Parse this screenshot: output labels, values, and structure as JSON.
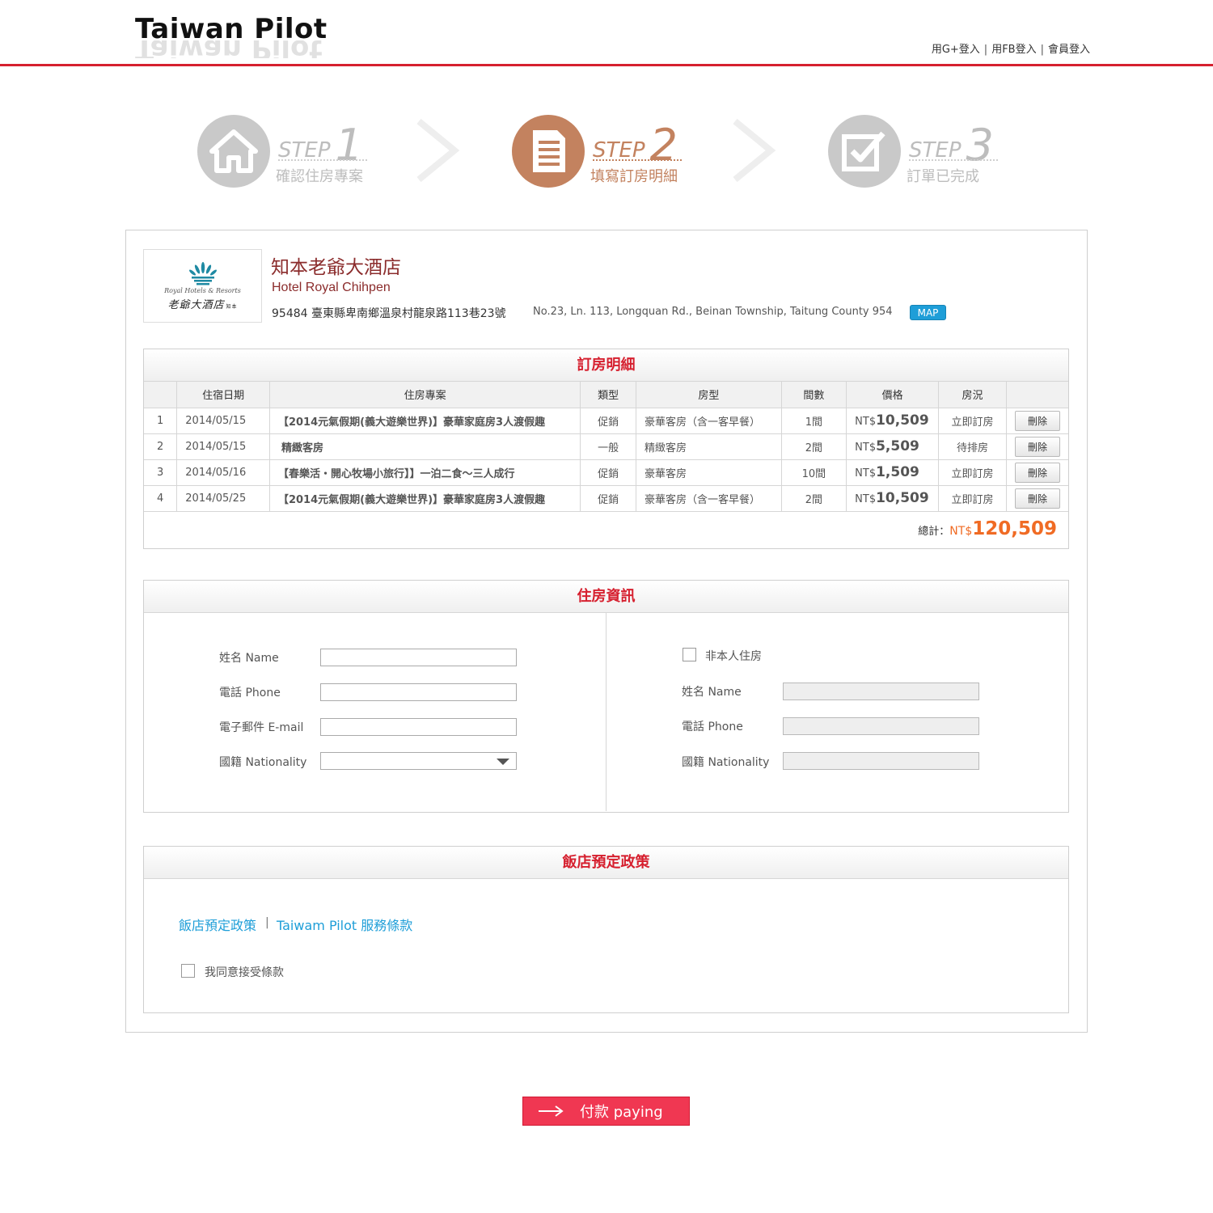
{
  "header": {
    "logo": "Taiwan Pilot",
    "links": [
      "用G+登入",
      "用FB登入",
      "會員登入"
    ]
  },
  "steps": [
    {
      "word": "STEP",
      "num": "1",
      "label": "確認住房專案",
      "icon": "house-icon",
      "active": false
    },
    {
      "word": "STEP",
      "num": "2",
      "label": "填寫訂房明細",
      "icon": "document-icon",
      "active": true
    },
    {
      "word": "STEP",
      "num": "3",
      "label": "訂單已完成",
      "icon": "checkmark-icon",
      "active": false
    }
  ],
  "hotel": {
    "logo_script": "Royal Hotels & Resorts",
    "logo_cn": "老爺大酒店",
    "logo_cn_small": "知本",
    "name_cn": "知本老爺大酒店",
    "name_en": "Hotel Royal Chihpen",
    "address": "95484 臺東縣卑南鄉溫泉村龍泉路113巷23號",
    "address_en": "No.23, Ln. 113, Longquan Rd., Beinan Township, Taitung County 954",
    "map_label": "MAP"
  },
  "booking": {
    "title": "訂房明細",
    "columns": [
      "",
      "住宿日期",
      "住房專案",
      "類型",
      "房型",
      "間數",
      "價格",
      "房況",
      ""
    ],
    "rows": [
      {
        "no": "1",
        "date": "2014/05/15",
        "plan": "【2014元氣假期(義大遊樂世界)】豪華家庭房3人渡假趣",
        "type": "促銷",
        "room": "豪華客房（含一客早餐）",
        "count": "1間",
        "currency": "NT$",
        "price": "10,509",
        "status": "立即訂房",
        "action": "刪除"
      },
      {
        "no": "2",
        "date": "2014/05/15",
        "plan": "精緻客房",
        "type": "一般",
        "room": "精緻客房",
        "count": "2間",
        "currency": "NT$",
        "price": "5,509",
        "status": "待排房",
        "action": "刪除"
      },
      {
        "no": "3",
        "date": "2014/05/16",
        "plan": "【春樂活・開心牧場小旅行】】一泊二食～三人成行",
        "type": "促銷",
        "room": "豪華客房",
        "count": "10間",
        "currency": "NT$",
        "price": "1,509",
        "status": "立即訂房",
        "action": "刪除"
      },
      {
        "no": "4",
        "date": "2014/05/25",
        "plan": "【2014元氣假期(義大遊樂世界)】豪華家庭房3人渡假趣",
        "type": "促銷",
        "room": "豪華客房（含一客早餐）",
        "count": "2間",
        "currency": "NT$",
        "price": "10,509",
        "status": "立即訂房",
        "action": "刪除"
      }
    ],
    "total_label": "總計：",
    "total_currency": "NT$",
    "total_amount": "120,509"
  },
  "guest": {
    "title": "住房資訊",
    "left": {
      "name_label": "姓名 Name",
      "phone_label": "電話 Phone",
      "email_label": "電子郵件 E-mail",
      "nationality_label": "國籍 Nationality"
    },
    "right": {
      "not_self_label": "非本人住房",
      "name_label": "姓名 Name",
      "phone_label": "電話 Phone",
      "nationality_label": "國籍 Nationality"
    }
  },
  "policy": {
    "title": "飯店預定政策",
    "link1": "飯店預定政策",
    "separator": "|",
    "link2": "Taiwam Pilot 服務條款",
    "agree_label": "我同意接受條款"
  },
  "pay_button": {
    "label": "付款 paying"
  },
  "colors": {
    "accent_red": "#d6202f",
    "step_active": "#c3825f",
    "price_orange": "#f06b24",
    "link_blue": "#1e9ed8",
    "pay_button": "#f03752"
  }
}
